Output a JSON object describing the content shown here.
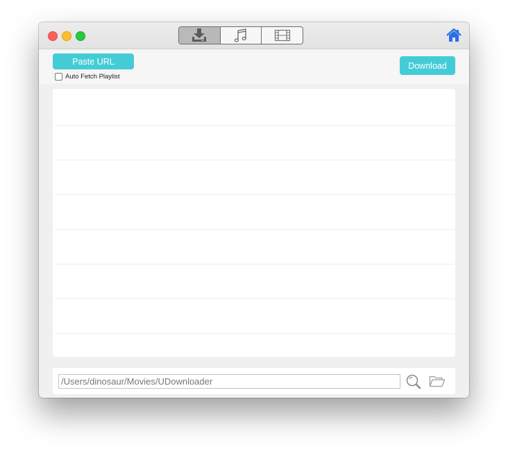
{
  "titlebar": {
    "traffic_lights": [
      "close",
      "minimize",
      "zoom"
    ],
    "tabs": [
      {
        "icon": "download-icon",
        "active": true
      },
      {
        "icon": "music-note-icon",
        "active": false
      },
      {
        "icon": "film-icon",
        "active": false
      }
    ],
    "home_icon": "home-icon",
    "home_color": "#2b6ee6"
  },
  "toolbar": {
    "paste_label": "Paste URL",
    "download_label": "Download",
    "auto_fetch_label": "Auto Fetch Playlist",
    "auto_fetch_checked": false,
    "accent_color": "#44ccd6"
  },
  "list": {
    "rows": 7
  },
  "bottom": {
    "path_value": "/Users/dinosaur/Movies/UDownloader",
    "search_icon": "search-icon",
    "folder_icon": "folder-icon"
  }
}
